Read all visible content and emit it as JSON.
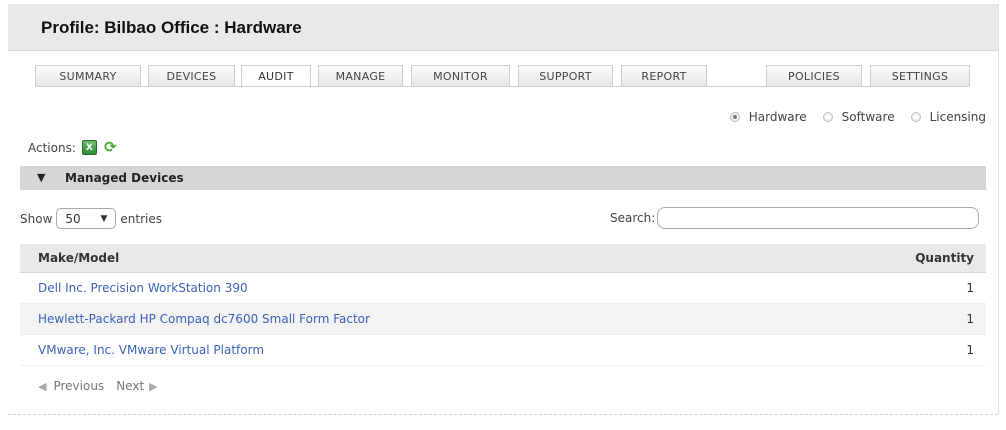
{
  "title": "Profile: Bilbao Office : Hardware",
  "tabs": [
    "SUMMARY",
    "DEVICES",
    "AUDIT",
    "MANAGE",
    "MONITOR",
    "SUPPORT",
    "REPORT",
    "POLICIES",
    "SETTINGS"
  ],
  "active_tab": "AUDIT",
  "radios": [
    {
      "label": "Hardware",
      "checked": true
    },
    {
      "label": "Software",
      "checked": false
    },
    {
      "label": "Licensing",
      "checked": false
    }
  ],
  "actions_label": "Actions:",
  "action_icons": [
    "excel-export-icon",
    "refresh-icon"
  ],
  "group_label": "Managed Devices",
  "show_label": "Show",
  "entries_value": "50",
  "entries_label": "entries",
  "search_label": "Search:",
  "search_value": "",
  "table": {
    "headers": [
      "Make/Model",
      "Quantity"
    ],
    "rows": [
      {
        "model": "Dell Inc. Precision WorkStation 390",
        "qty": "1"
      },
      {
        "model": "Hewlett-Packard HP Compaq dc7600 Small Form Factor",
        "qty": "1"
      },
      {
        "model": "VMware, Inc. VMware Virtual Platform",
        "qty": "1"
      }
    ]
  },
  "pager": {
    "previous": "Previous",
    "next": "Next"
  }
}
